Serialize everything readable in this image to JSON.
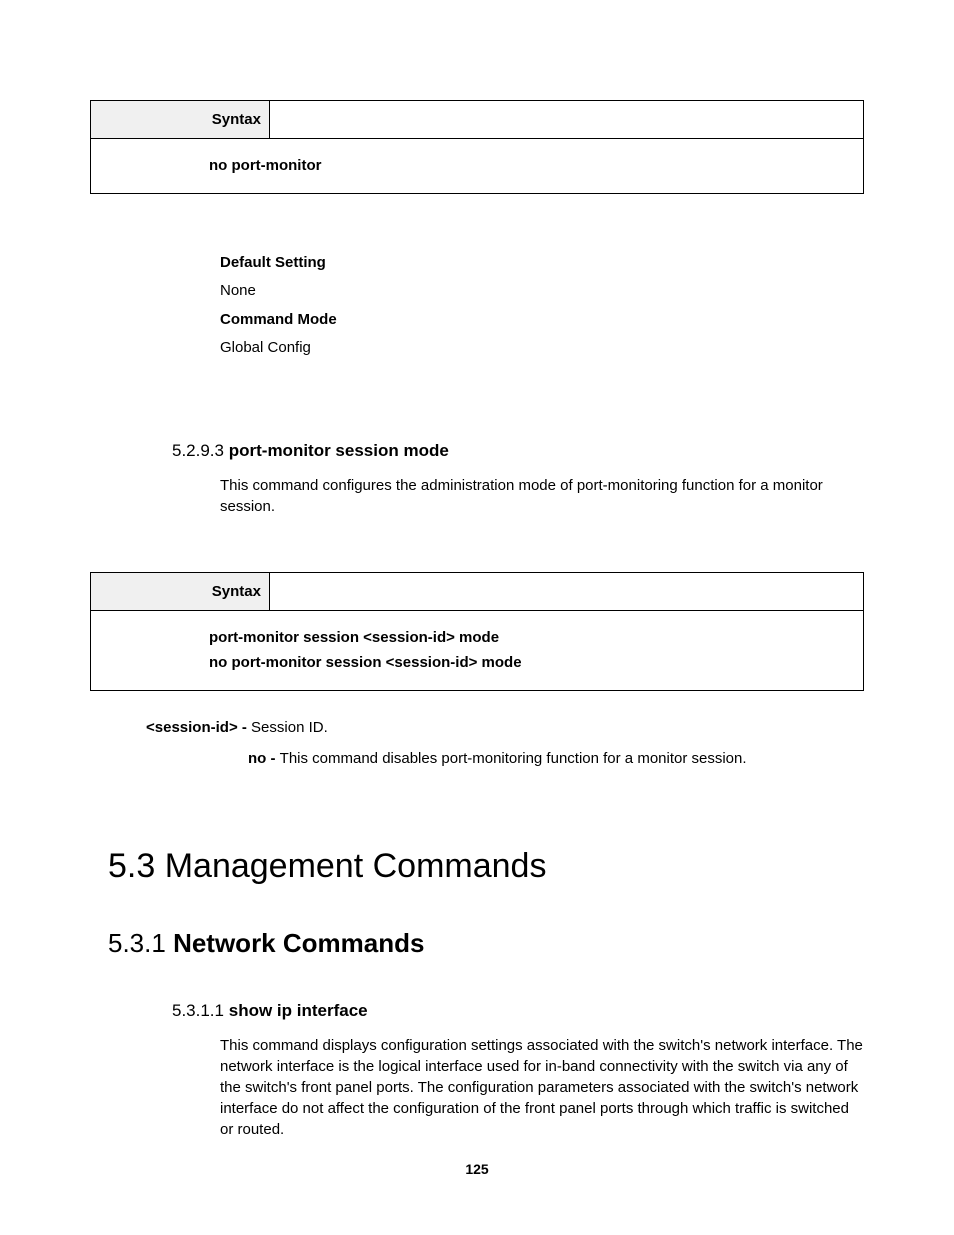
{
  "syntax1": {
    "label": "Syntax",
    "command": "no port-monitor"
  },
  "details1": {
    "default_label": "Default Setting",
    "default_value": "None",
    "mode_label": "Command Mode",
    "mode_value": "Global Config"
  },
  "section5293": {
    "number": "5.2.9.3",
    "title": "port-monitor session mode",
    "description": "This command configures the administration mode of port-monitoring function for a monitor session."
  },
  "syntax2": {
    "label": "Syntax",
    "line1": "port-monitor session <session-id> mode",
    "line2": "no port-monitor session <session-id> mode"
  },
  "params": {
    "session_id_label": "<session-id> - ",
    "session_id_desc": "Session ID.",
    "no_label": "no - ",
    "no_desc": "This command disables port-monitoring function for a monitor session."
  },
  "section53": {
    "title": "5.3 Management Commands"
  },
  "section531": {
    "number": "5.3.1",
    "title": "Network Commands"
  },
  "section5311": {
    "number": "5.3.1.1",
    "title": "show ip interface",
    "description": "This command displays configuration settings associated with the switch's network interface. The network interface is the logical interface used for in-band connectivity with the switch via any of the switch's front panel ports. The configuration parameters associated with the switch's network interface do not affect the configuration of the front panel ports through which traffic is switched or routed."
  },
  "page_number": "125"
}
